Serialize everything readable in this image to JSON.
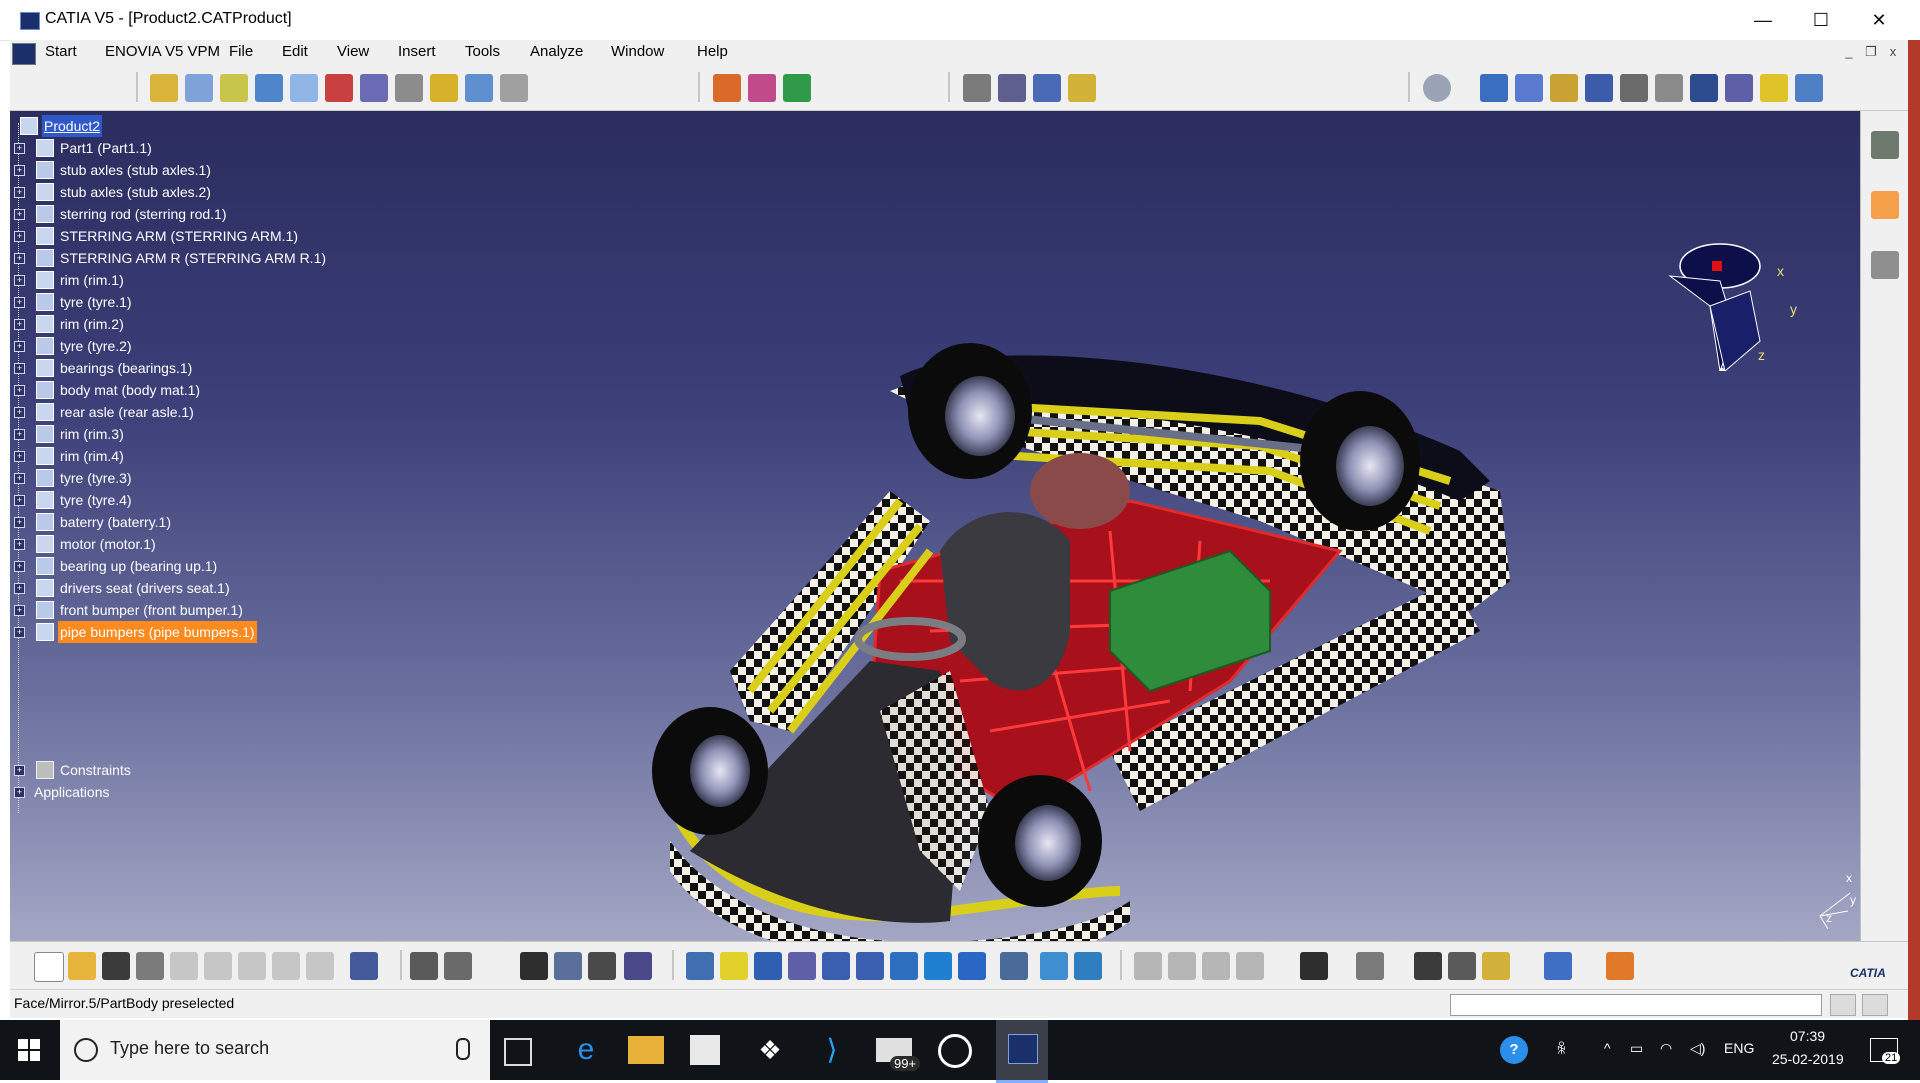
{
  "window": {
    "title": "CATIA V5 - [Product2.CATProduct]",
    "minimize": "—",
    "maximize": "☐",
    "close": "✕"
  },
  "menu": [
    "Start",
    "ENOVIA V5 VPM",
    "File",
    "Edit",
    "View",
    "Insert",
    "Tools",
    "Analyze",
    "Window",
    "Help"
  ],
  "mdi": {
    "minimize": "_",
    "restore": "❐",
    "close": "x"
  },
  "tree": {
    "root": "Product2",
    "nodes": [
      "Part1 (Part1.1)",
      "stub axles (stub axles.1)",
      "stub axles (stub axles.2)",
      "sterring rod (sterring rod.1)",
      "STERRING ARM (STERRING ARM.1)",
      "STERRING ARM R (STERRING ARM R.1)",
      "rim (rim.1)",
      "tyre (tyre.1)",
      "rim (rim.2)",
      "tyre (tyre.2)",
      "bearings (bearings.1)",
      "body mat (body mat.1)",
      "rear asle (rear asle.1)",
      "rim (rim.3)",
      "rim (rim.4)",
      "tyre (tyre.3)",
      "tyre (tyre.4)",
      "baterry (baterry.1)",
      "motor (motor.1)",
      "bearing up (bearing up.1)",
      "drivers seat (drivers seat.1)",
      "front bumper (front bumper.1)",
      "pipe bumpers (pipe bumpers.1)"
    ],
    "selected_index": 22,
    "constraints": "Constraints",
    "applications": "Applications"
  },
  "compass": {
    "x": "x",
    "y": "y",
    "z": "z"
  },
  "axis": {
    "x": "x",
    "y": "y",
    "z": "z"
  },
  "brand": "CATIA",
  "status": {
    "message": "Face/Mirror.5/PartBody preselected"
  },
  "taskbar": {
    "search_placeholder": "Type here to search",
    "mail_badge": "99+",
    "language": "ENG",
    "time": "07:39",
    "date": "25-02-2019",
    "notification_count": "21"
  },
  "colors": {
    "viewport_top": "#2b2d5f",
    "viewport_bottom": "#a4a7c4",
    "selection": "#ff8a1e",
    "frame_red": "#b3121c",
    "tube_yellow": "#d9cf1a"
  }
}
